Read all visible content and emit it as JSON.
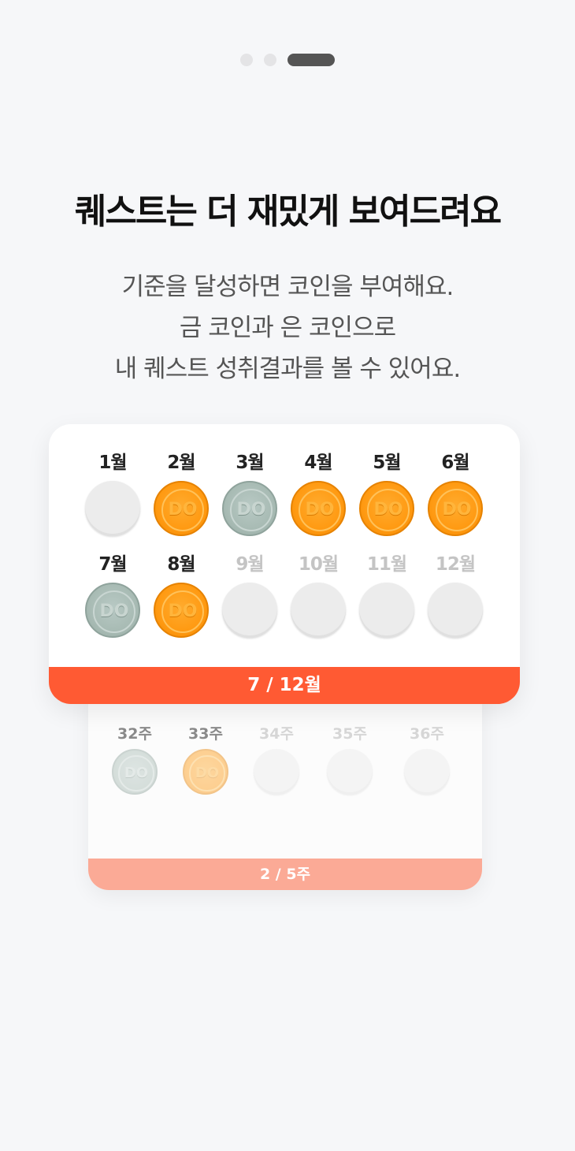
{
  "pager": {
    "count": 3,
    "active": 2
  },
  "title": "퀘스트는 더 재밌게 보여드려요",
  "description": [
    "기준을 달성하면 코인을 부여해요.",
    "금 코인과 은 코인으로",
    "내 퀘스트 성취결과를 볼 수 있어요."
  ],
  "monthly_card": {
    "months": [
      {
        "label": "1월",
        "coin": "empty",
        "active": true
      },
      {
        "label": "2월",
        "coin": "gold",
        "active": true
      },
      {
        "label": "3월",
        "coin": "silver",
        "active": true
      },
      {
        "label": "4월",
        "coin": "gold",
        "active": true
      },
      {
        "label": "5월",
        "coin": "gold",
        "active": true
      },
      {
        "label": "6월",
        "coin": "gold",
        "active": true
      },
      {
        "label": "7월",
        "coin": "silver",
        "active": true
      },
      {
        "label": "8월",
        "coin": "gold",
        "active": true
      },
      {
        "label": "9월",
        "coin": "empty",
        "active": false
      },
      {
        "label": "10월",
        "coin": "empty",
        "active": false
      },
      {
        "label": "11월",
        "coin": "empty",
        "active": false
      },
      {
        "label": "12월",
        "coin": "empty",
        "active": false
      }
    ],
    "footer": "7 / 12월"
  },
  "weekly_card": {
    "weeks": [
      {
        "label": "32주",
        "coin": "silver",
        "active": true
      },
      {
        "label": "33주",
        "coin": "gold",
        "active": true
      },
      {
        "label": "34주",
        "coin": "empty",
        "active": false
      },
      {
        "label": "35주",
        "coin": "empty",
        "active": false
      },
      {
        "label": "36주",
        "coin": "empty",
        "active": false
      }
    ],
    "footer": "2 / 5주"
  },
  "coin_text": "DO",
  "colors": {
    "accent": "#ff5a33",
    "accent_faded": "#fbaa96",
    "gold": "#ff9a12",
    "silver": "#a8bbb4",
    "empty": "#ececec"
  }
}
